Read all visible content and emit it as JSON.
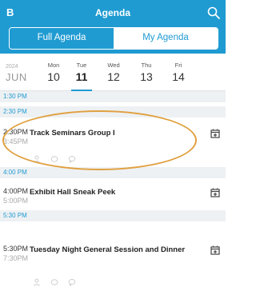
{
  "header": {
    "logo_letter": "B",
    "title": "Agenda",
    "search_icon": "search-icon"
  },
  "segments": {
    "full_agenda": "Full Agenda",
    "my_agenda": "My Agenda",
    "active": "full_agenda"
  },
  "date_picker": {
    "year": "2024",
    "month": "JUN",
    "days": [
      {
        "dow": "Mon",
        "num": "10"
      },
      {
        "dow": "Tue",
        "num": "11"
      },
      {
        "dow": "Wed",
        "num": "12"
      },
      {
        "dow": "Thu",
        "num": "13"
      },
      {
        "dow": "Fri",
        "num": "14"
      }
    ],
    "selected_index": 1
  },
  "time_bands": [
    "1:30 PM",
    "2:30 PM",
    "4:00 PM",
    "5:30 PM"
  ],
  "sessions": [
    {
      "start": "2:30PM",
      "end": "3:45PM",
      "title": "Track Seminars Group I"
    },
    {
      "start": "4:00PM",
      "end": "5:00PM",
      "title": "Exhibit Hall Sneak Peek"
    },
    {
      "start": "5:30PM",
      "end": "7:30PM",
      "title": "Tuesday Night General Session and Dinner"
    }
  ],
  "colors": {
    "accent": "#1f9bd2",
    "highlight": "#e0a040",
    "band_bg": "#eef1f3"
  }
}
